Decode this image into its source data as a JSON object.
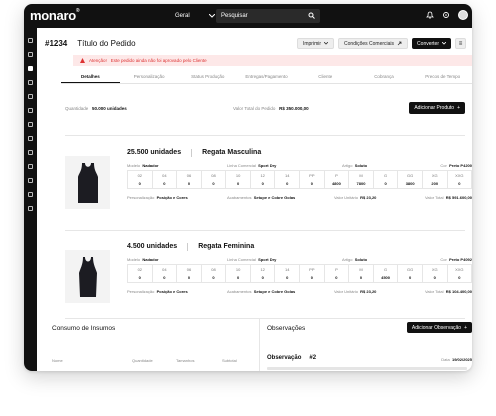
{
  "topbar": {
    "logo": "monaro",
    "logo_mark": "®",
    "scope_select": "Geral",
    "search_placeholder": "Pesquisar",
    "icons": [
      "chevron-down-icon",
      "search-icon",
      "bell-icon",
      "gear-icon",
      "avatar"
    ]
  },
  "sidebar": {
    "icons": [
      "dashboard-icon",
      "document-icon",
      "box-icon",
      "user-icon",
      "list-icon",
      "grid-icon",
      "calendar-icon",
      "clipboard-icon",
      "chart-icon",
      "settings-icon",
      "tag-icon",
      "truck-icon",
      "help-icon"
    ]
  },
  "header": {
    "order_number": "#1234",
    "order_title": "Título do Pedido",
    "print_label": "Imprimir",
    "commercial_label": "Condições Comerciais",
    "convert_label": "Converter",
    "more_label": "≡"
  },
  "alert": {
    "prefix": "Atenção!",
    "message": "Este pedido ainda não foi aprovado pelo Cliente",
    "color": "#d33333"
  },
  "tabs": [
    {
      "label": "Detalhes",
      "active": true
    },
    {
      "label": "Personalização",
      "active": false
    },
    {
      "label": "Status Produção",
      "active": false
    },
    {
      "label": "Entregas/Pagamento",
      "active": false
    },
    {
      "label": "Cliente",
      "active": false
    },
    {
      "label": "Cobrança",
      "active": false
    },
    {
      "label": "Precos de Tempo",
      "active": false
    }
  ],
  "summary": {
    "qty_label": "Quantidade",
    "qty_value": "50.000 unidades",
    "total_label": "Valor Total do Pedido",
    "total_value": "R$ 350.000,00",
    "add_product_label": "Adicionar Produto"
  },
  "products": [
    {
      "units": "25.500 unidades",
      "name": "Regata Masculina",
      "meta": {
        "model_label": "Modelo",
        "model": "Nadador",
        "line_label": "Linha Comercial",
        "line": "Sport Dry",
        "fabric_label": "Artigo",
        "fabric": "Soluto",
        "color_label": "Cor",
        "color": "Preto P4200"
      },
      "sizes": [
        "02",
        "04",
        "06",
        "08",
        "10",
        "12",
        "14",
        "PP",
        "P",
        "M",
        "G",
        "GG",
        "XG",
        "XXG"
      ],
      "quantities": [
        "0",
        "0",
        "0",
        "0",
        "0",
        "0",
        "0",
        "0",
        "4800",
        "7800",
        "0",
        "3800",
        "200",
        "0"
      ],
      "footer": {
        "pers_label": "Personalização",
        "pers": "Posição e Cores",
        "finish_label": "Acabamentos",
        "finish": "Setupe e Cobre Golas",
        "unit_label": "Valor Unitário",
        "unit": "R$ 23,20",
        "total_label": "Valor Total",
        "total": "R$ 591.600,00"
      }
    },
    {
      "units": "4.500 unidades",
      "name": "Regata Feminina",
      "meta": {
        "model_label": "Modelo",
        "model": "Nadador",
        "line_label": "Linha Comercial",
        "line": "Sport Dry",
        "fabric_label": "Artigo",
        "fabric": "Soluto",
        "color_label": "Cor",
        "color": "Preto P4092"
      },
      "sizes": [
        "02",
        "04",
        "06",
        "08",
        "10",
        "12",
        "14",
        "PP",
        "P",
        "M",
        "G",
        "GG",
        "XG",
        "XXG"
      ],
      "quantities": [
        "0",
        "0",
        "0",
        "0",
        "0",
        "0",
        "0",
        "0",
        "0",
        "0",
        "4500",
        "0",
        "0",
        "0"
      ],
      "footer": {
        "pers_label": "Personalização",
        "pers": "Posição e Cores",
        "finish_label": "Acabamentos",
        "finish": "Setupe e Cobre Golas",
        "unit_label": "Valor Unitário",
        "unit": "R$ 23,20",
        "total_label": "Valor Total",
        "total": "R$ 104.400,00"
      }
    }
  ],
  "insumos": {
    "title": "Consumo de Insumos",
    "headers": [
      "Nome",
      "Quantidade",
      "Tamanhos",
      "Subtotal"
    ]
  },
  "observacoes": {
    "title": "Observações",
    "add_label": "Adicionar Observação",
    "item_label": "Observação",
    "item_number": "#2",
    "date_label": "Data",
    "date_value": "19/02/2025"
  }
}
